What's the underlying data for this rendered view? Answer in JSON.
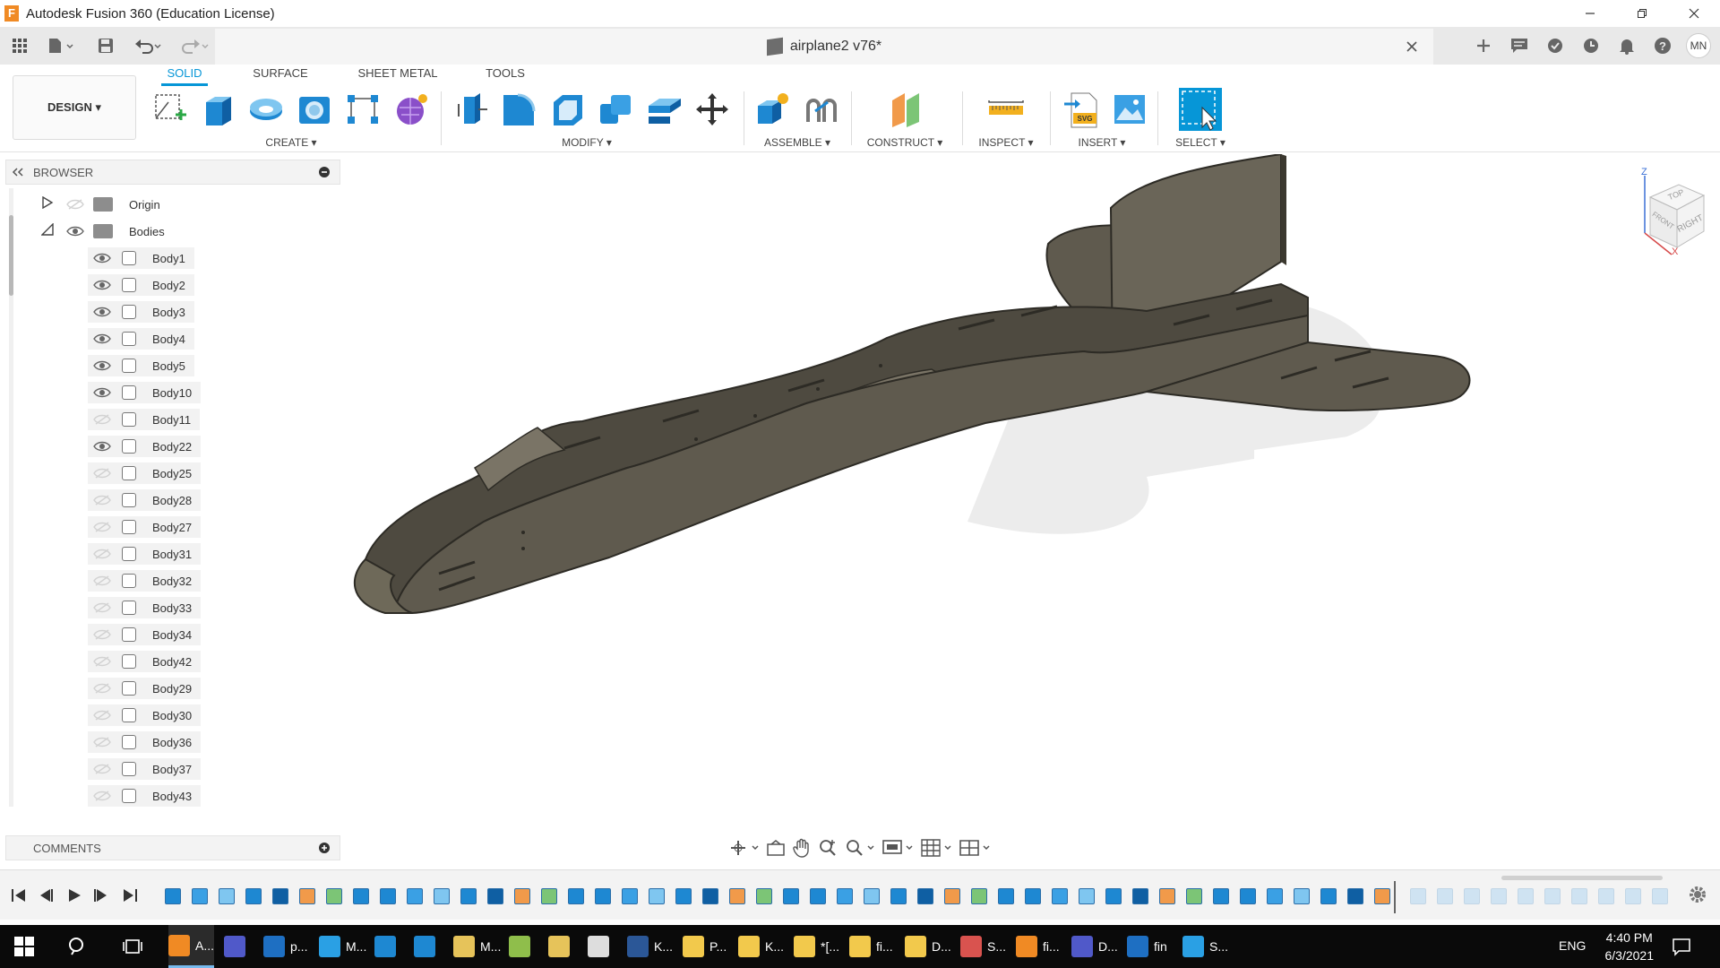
{
  "window": {
    "title": "Autodesk Fusion 360 (Education License)",
    "app_letter": "F"
  },
  "document": {
    "title": "airplane2 v76*"
  },
  "user": {
    "initials": "MN"
  },
  "ribbon": {
    "workspace": "DESIGN ▾",
    "tabs": [
      "SOLID",
      "SURFACE",
      "SHEET METAL",
      "TOOLS"
    ],
    "active_tab": "SOLID",
    "groups": [
      "CREATE ▾",
      "MODIFY ▾",
      "ASSEMBLE ▾",
      "CONSTRUCT ▾",
      "INSPECT ▾",
      "INSERT ▾",
      "SELECT ▾"
    ]
  },
  "browser": {
    "title": "BROWSER",
    "folders": [
      {
        "label": "Origin",
        "visible": false,
        "expanded": false
      },
      {
        "label": "Bodies",
        "visible": true,
        "expanded": true
      }
    ],
    "bodies": [
      {
        "label": "Body1",
        "visible": true
      },
      {
        "label": "Body2",
        "visible": true
      },
      {
        "label": "Body3",
        "visible": true
      },
      {
        "label": "Body4",
        "visible": true
      },
      {
        "label": "Body5",
        "visible": true
      },
      {
        "label": "Body10",
        "visible": true
      },
      {
        "label": "Body11",
        "visible": false
      },
      {
        "label": "Body22",
        "visible": true
      },
      {
        "label": "Body25",
        "visible": false
      },
      {
        "label": "Body28",
        "visible": false
      },
      {
        "label": "Body27",
        "visible": false
      },
      {
        "label": "Body31",
        "visible": false
      },
      {
        "label": "Body32",
        "visible": false
      },
      {
        "label": "Body33",
        "visible": false
      },
      {
        "label": "Body34",
        "visible": false
      },
      {
        "label": "Body42",
        "visible": false
      },
      {
        "label": "Body29",
        "visible": false
      },
      {
        "label": "Body30",
        "visible": false
      },
      {
        "label": "Body36",
        "visible": false
      },
      {
        "label": "Body37",
        "visible": false
      },
      {
        "label": "Body43",
        "visible": false
      }
    ]
  },
  "comments": {
    "title": "COMMENTS"
  },
  "viewcube": {
    "face_right": "RIGHT",
    "face_front": "FRONT",
    "face_top": "TOP",
    "axis_z": "Z",
    "axis_x": "X"
  },
  "taskbar": {
    "items": [
      "A...",
      "p...",
      "M...",
      "M...",
      "K...",
      "P...",
      "K...",
      "*[...",
      "fi...",
      "D...",
      "S...",
      "fi...",
      "D...",
      "fin",
      "S..."
    ],
    "language": "ENG",
    "time": "4:40 PM",
    "date": "6/3/2021"
  },
  "colors": {
    "accent": "#0696d7",
    "model_body": "#5f5a4e",
    "model_edge": "#2d2b25",
    "shadow": "#e6e6e6"
  }
}
